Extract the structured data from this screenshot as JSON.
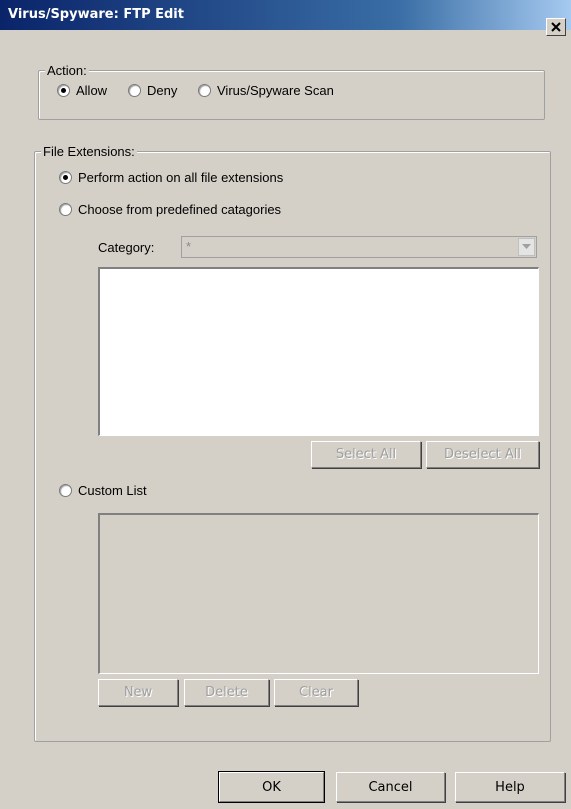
{
  "window": {
    "title": "Virus/Spyware: FTP Edit",
    "close_icon": "close-icon"
  },
  "action": {
    "legend": "Action:",
    "options": [
      {
        "label": "Allow",
        "checked": true
      },
      {
        "label": "Deny",
        "checked": false
      },
      {
        "label": "Virus/Spyware Scan",
        "checked": false
      }
    ]
  },
  "file_extensions": {
    "legend": "File Extensions:",
    "option_all": {
      "label": "Perform action on all file extensions",
      "checked": true
    },
    "option_predefined": {
      "label": "Choose from predefined catagories",
      "checked": false
    },
    "category_label": "Category:",
    "category_value": "*",
    "select_all": "Select All",
    "deselect_all": "Deselect All",
    "option_custom": {
      "label": "Custom List",
      "checked": false
    },
    "new_label": "New",
    "delete_label": "Delete",
    "clear_label": "Clear"
  },
  "footer": {
    "ok": "OK",
    "cancel": "Cancel",
    "help": "Help"
  },
  "colors": {
    "dialog_bg": "#d4d0c8",
    "title_bar": "#0a246a",
    "disabled_text": "#a0a0a0"
  }
}
